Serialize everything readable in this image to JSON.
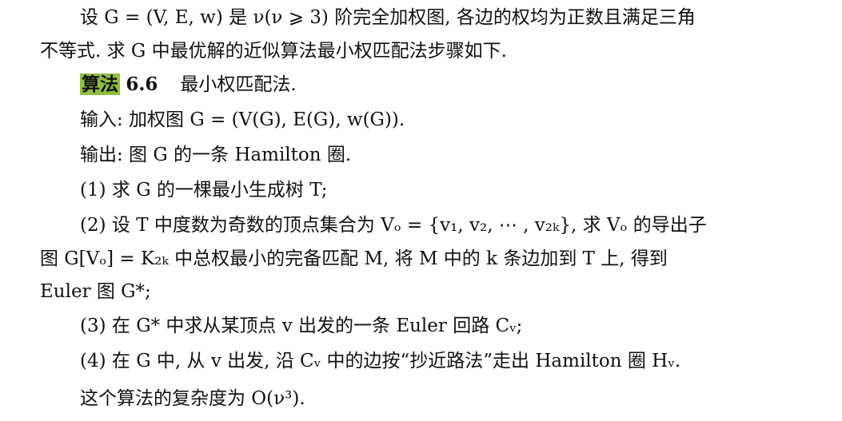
{
  "paragraphs": [
    "设 G = (V, E, w) 是 ν(ν ⩾ 3) 阶完全加权图, 各边的权均为正数且满足三角",
    "不等式. 求 G 中最优解的近似算法最小权匹配法步骤如下."
  ],
  "algorithm": {
    "label": "算法",
    "number": "6.6",
    "name": "最小权匹配法."
  },
  "input": "输入: 加权图 G = (V(G), E(G), w(G)).",
  "output": "输出: 图 G 的一条 Hamilton 圈.",
  "steps": [
    "(1) 求 G 的一棵最小生成树 T;",
    "(2) 设 T 中度数为奇数的顶点集合为 Vₒ = {v₁, v₂, ⋯ , v₂ₖ}, 求 Vₒ 的导出子",
    "图 G[Vₒ] = K₂ₖ 中总权最小的完备匹配 M, 将 M 中的 k 条边加到 T 上, 得到",
    "Euler 图 G*;",
    "(3) 在 G* 中求从某顶点 v 出发的一条 Euler 回路 Cᵥ;",
    "(4) 在 G 中, 从 v 出发, 沿 Cᵥ 中的边按“抄近路法”走出 Hamilton 圈 Hᵥ."
  ],
  "complexity": "这个算法的复杂度为 O(ν³).",
  "colors": {
    "highlight": "#8fbf3f",
    "text": "#111111",
    "background": "#ffffff"
  }
}
